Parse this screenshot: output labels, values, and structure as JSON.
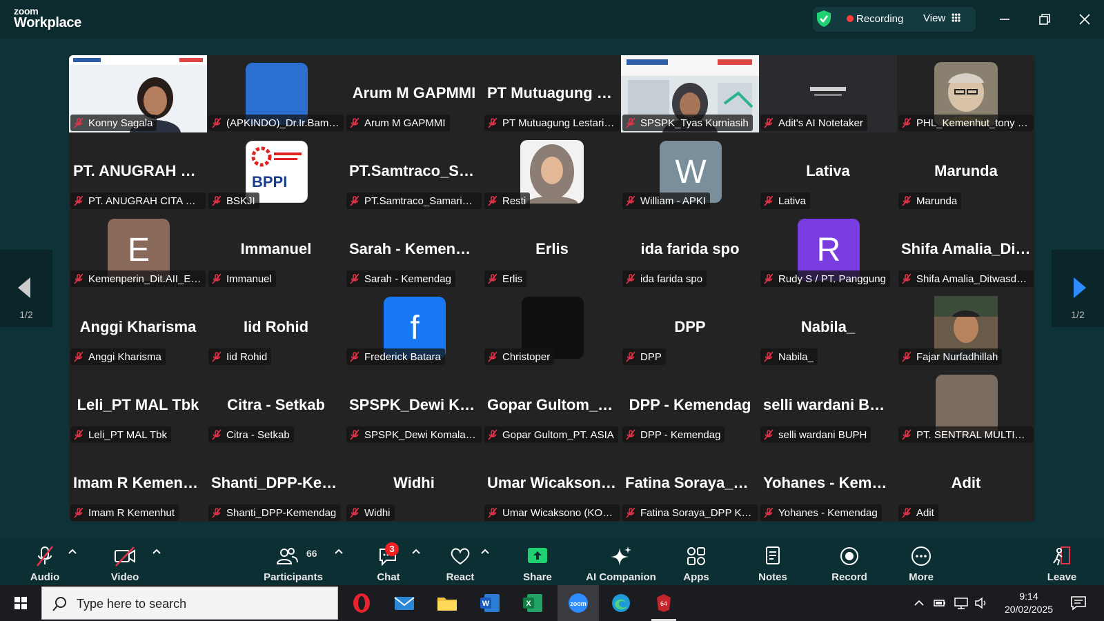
{
  "app": {
    "brand_top": "zoom",
    "brand_bottom": "Workplace"
  },
  "status": {
    "recording": "Recording",
    "view": "View"
  },
  "tiles": [
    {
      "big": "",
      "name": "Konny Sagala",
      "video": "konny"
    },
    {
      "big": "",
      "name": "(APKINDO)_Dr.Ir.Bambang S.",
      "avatar": {
        "letter": "",
        "color": "#2b6fd1"
      }
    },
    {
      "big": "Arum M GAPMMI",
      "name": "Arum M GAPMMI"
    },
    {
      "big": "PT Mutuagung Lestari",
      "name": "PT Mutuagung Lestari Tbk"
    },
    {
      "big": "",
      "name": "SPSPK_Tyas Kurniasih",
      "video": "tyas",
      "active": true
    },
    {
      "big": "",
      "name": "Adit's AI Notetaker",
      "video": "notetaker"
    },
    {
      "big": "",
      "name": "PHL_Kemenhut_tony (Kemenhut)",
      "video": "tony"
    },
    {
      "big": "PT. ANUGRAH CITA ERA",
      "name": "PT. ANUGRAH CITA ERA FORESTA"
    },
    {
      "big": "",
      "name": "BSKJI",
      "avatar": {
        "letter": "",
        "color": "#ffffff",
        "logo": "BPPI"
      }
    },
    {
      "big": "PT.Samtraco_Samarinda",
      "name": "PT.Samtraco_Samarinda"
    },
    {
      "big": "",
      "name": "Resti",
      "video": "resti"
    },
    {
      "big": "",
      "name": "William - APKI",
      "avatar": {
        "letter": "W",
        "color": "#7a8f9b"
      }
    },
    {
      "big": "Lativa",
      "name": "Lativa"
    },
    {
      "big": "Marunda",
      "name": "Marunda"
    },
    {
      "big": "",
      "name": "Kemenperin_Dit.AII_Eva",
      "avatar": {
        "letter": "E",
        "color": "#8a6b5b"
      }
    },
    {
      "big": "Immanuel",
      "name": "Immanuel"
    },
    {
      "big": "Sarah - Kemendag",
      "name": "Sarah - Kemendag"
    },
    {
      "big": "Erlis",
      "name": "Erlis"
    },
    {
      "big": "ida farida spo",
      "name": "ida farida spo"
    },
    {
      "big": "",
      "name": "Rudy S / PT. Panggung",
      "avatar": {
        "letter": "R",
        "color": "#7a3de0"
      }
    },
    {
      "big": "Shifa Amalia_Ditwasdaglu",
      "name": "Shifa Amalia_Ditwasdaglu"
    },
    {
      "big": "Anggi Kharisma",
      "name": "Anggi Kharisma"
    },
    {
      "big": "Iid Rohid",
      "name": "Iid Rohid"
    },
    {
      "big": "",
      "name": "Frederick Batara",
      "avatar": {
        "letter": "f",
        "color": "#1877f2"
      }
    },
    {
      "big": "",
      "name": "Christoper",
      "avatar": {
        "letter": "",
        "color": "#0f0f0f"
      }
    },
    {
      "big": "DPP",
      "name": "DPP"
    },
    {
      "big": "Nabila_",
      "name": "Nabila_"
    },
    {
      "big": "",
      "name": "Fajar Nurfadhillah",
      "video": "fajar"
    },
    {
      "big": "Leli_PT MAL Tbk",
      "name": "Leli_PT MAL Tbk"
    },
    {
      "big": "Citra - Setkab",
      "name": "Citra - Setkab"
    },
    {
      "big": "SPSPK_Dewi Komalasari",
      "name": "SPSPK_Dewi Komalasari"
    },
    {
      "big": "Gopar Gultom_PT. ASI",
      "name": "Gopar Gultom_PT. ASIA"
    },
    {
      "big": "DPP - Kemendag",
      "name": "DPP - Kemendag"
    },
    {
      "big": "selli wardani BUPH",
      "name": "selli wardani BUPH"
    },
    {
      "big": "",
      "name": "PT. SENTRAL MULTIRAGAM",
      "avatar": {
        "letter": "",
        "color": "#7b6c62"
      }
    },
    {
      "big": "Imam R Kemenhut",
      "name": "Imam R Kemenhut"
    },
    {
      "big": "Shanti_DPP-Kemendag",
      "name": "Shanti_DPP-Kemendag"
    },
    {
      "big": "Widhi",
      "name": "Widhi"
    },
    {
      "big": "Umar Wicaksono (KOPERASI)",
      "name": "Umar Wicaksono (KOPERASI)"
    },
    {
      "big": "Fatina Soraya_DPP Kemendag",
      "name": "Fatina Soraya_DPP Kemendag"
    },
    {
      "big": "Yohanes - Kemendag",
      "name": "Yohanes - Kemendag"
    },
    {
      "big": "Adit",
      "name": "Adit"
    }
  ],
  "paging": {
    "left": "1/2",
    "right": "1/2"
  },
  "toolbar": {
    "audio": "Audio",
    "video": "Video",
    "participants": "Participants",
    "participants_count": "66",
    "chat": "Chat",
    "chat_badge": "3",
    "react": "React",
    "share": "Share",
    "ai_companion": "AI Companion",
    "apps": "Apps",
    "notes": "Notes",
    "record": "Record",
    "more": "More",
    "leave": "Leave"
  },
  "taskbar": {
    "search_placeholder": "Type here to search",
    "time": "9:14",
    "date": "20/02/2025"
  },
  "colors": {
    "active_speaker": "#1fd171",
    "share_green": "#1fd171",
    "recording": "#ff3b3b"
  }
}
